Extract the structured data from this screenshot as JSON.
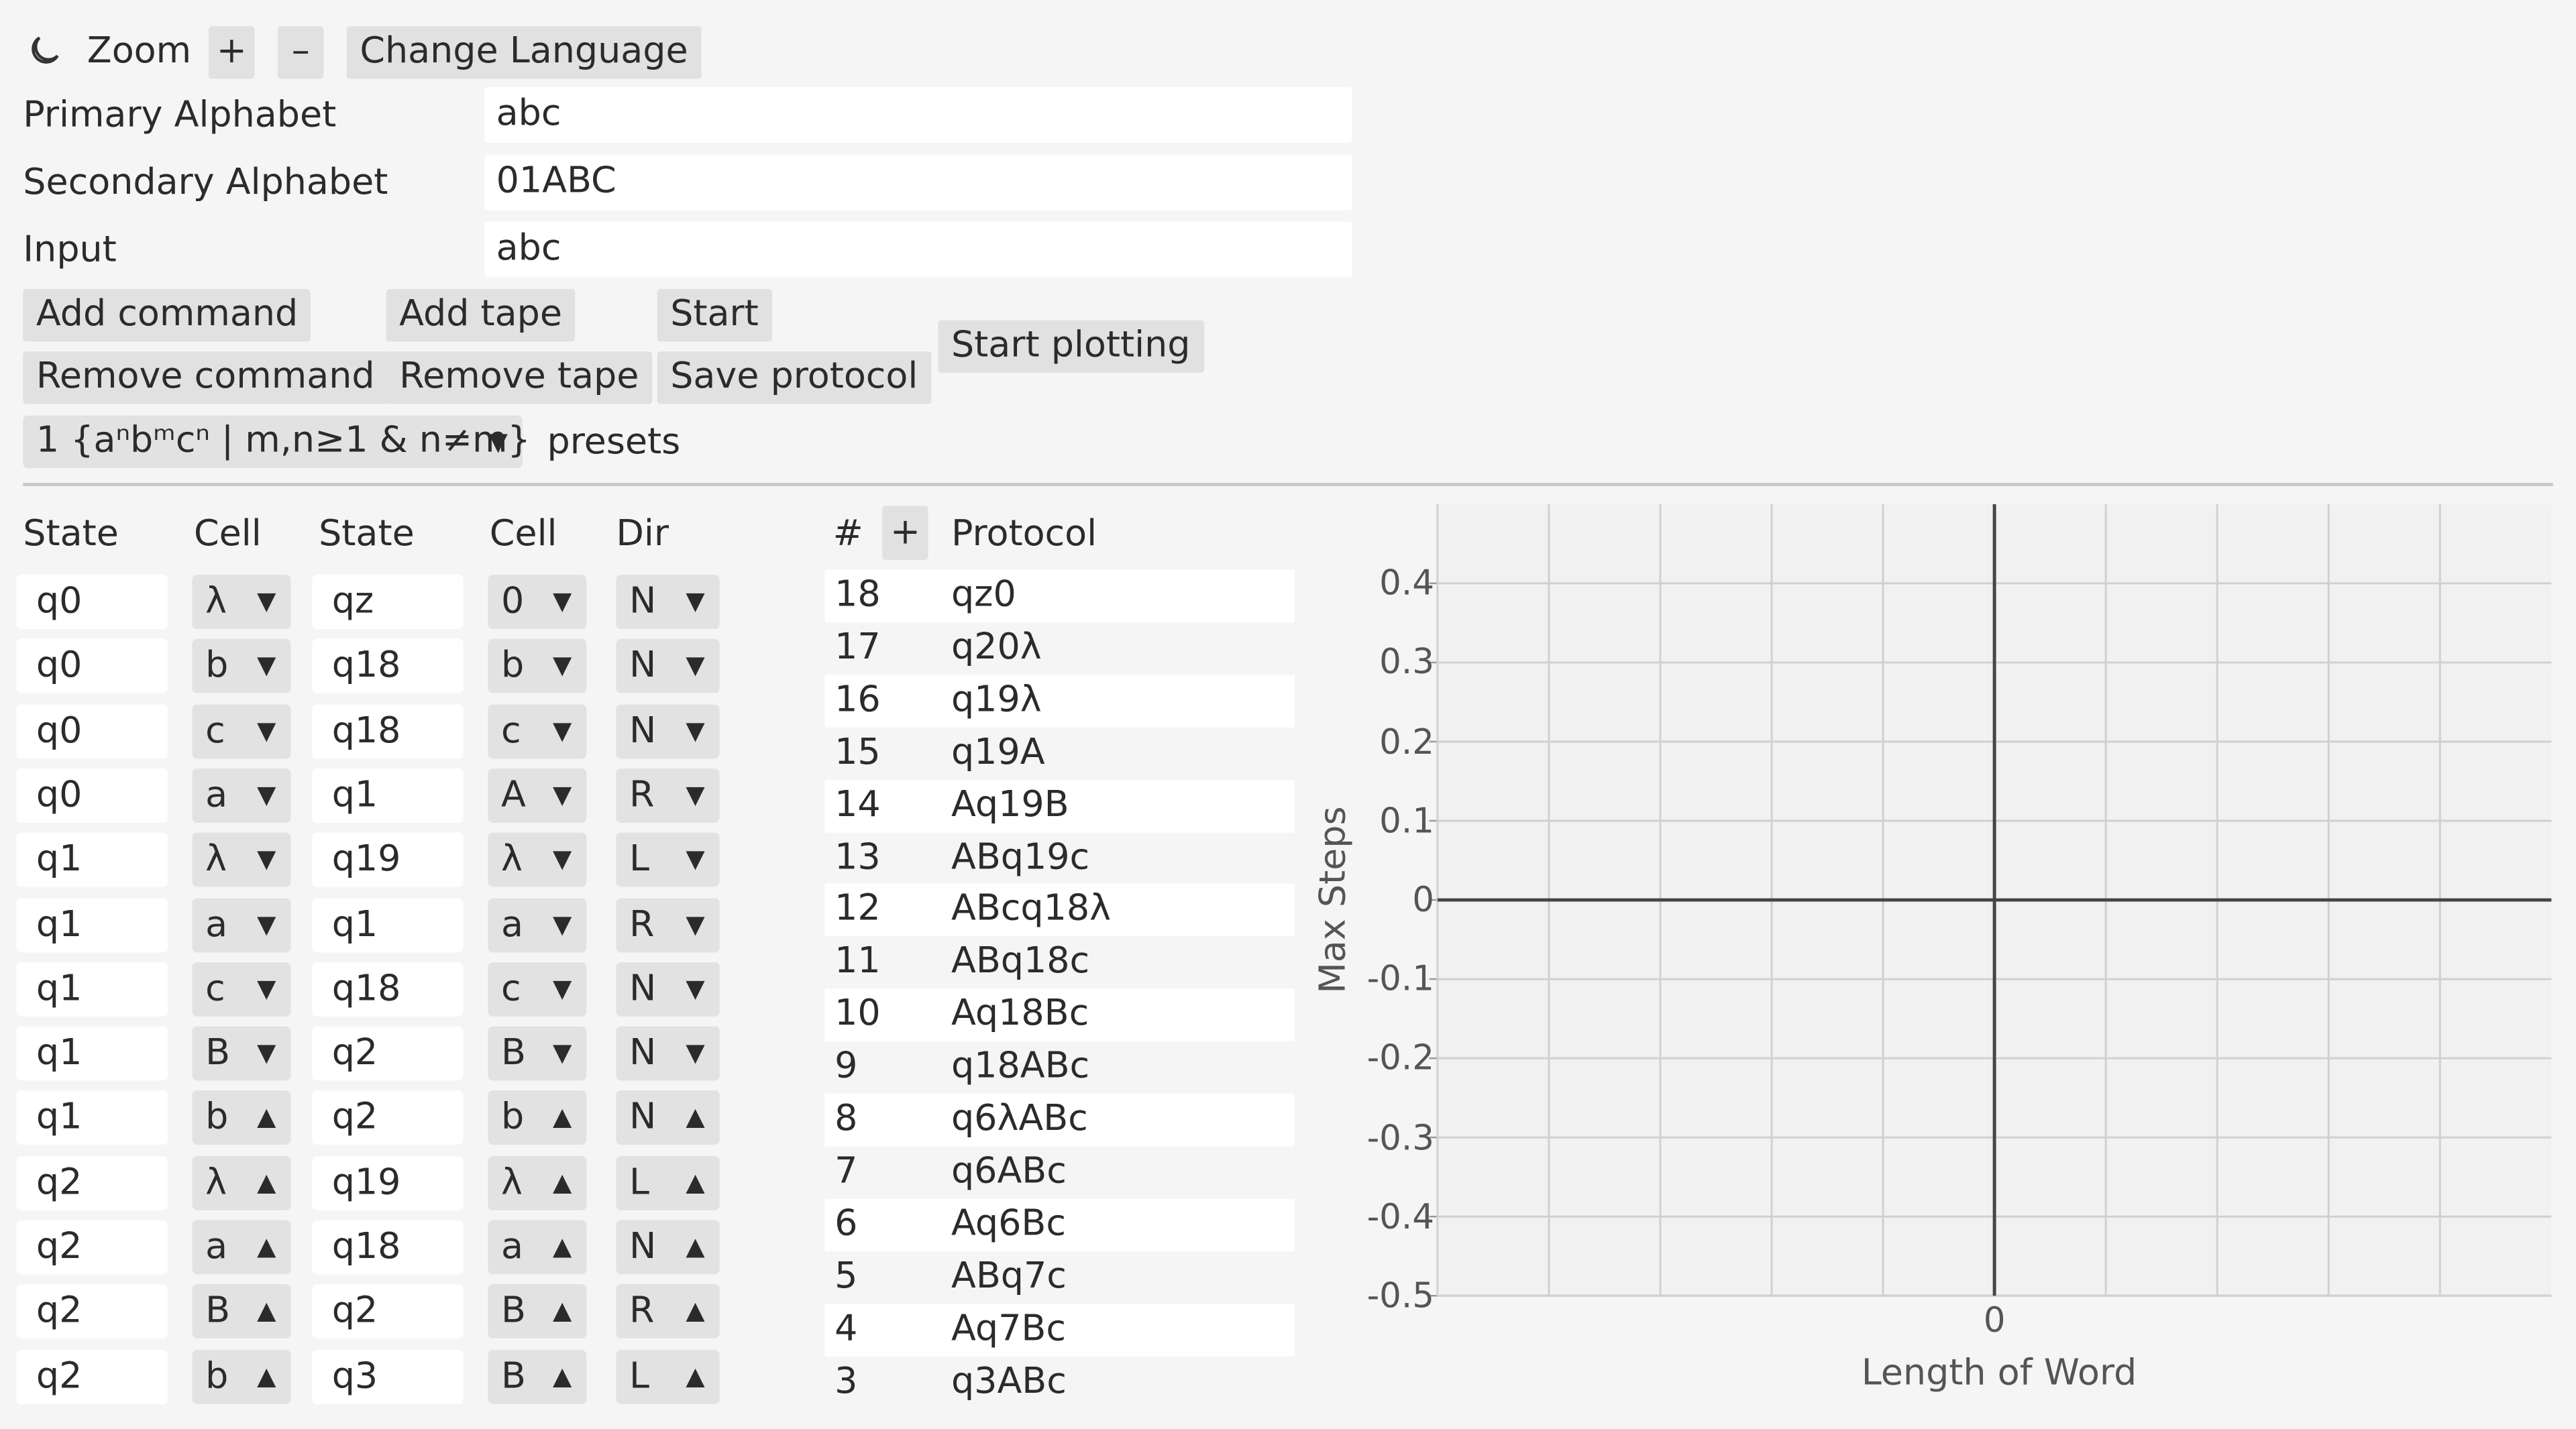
{
  "toolbar": {
    "theme_icon": "moon-icon",
    "zoom_label": "Zoom",
    "zoom_in": "+",
    "zoom_out": "–",
    "language_button": "Change Language"
  },
  "form": {
    "primary_label": "Primary Alphabet",
    "primary_value": "abc",
    "secondary_label": "Secondary Alphabet",
    "secondary_value": "01ABC",
    "input_label": "Input",
    "input_value": "abc"
  },
  "actions": {
    "add_command": "Add command",
    "remove_command": "Remove command",
    "add_tape": "Add tape",
    "remove_tape": "Remove tape",
    "start": "Start",
    "save_protocol": "Save protocol",
    "start_plotting": "Start plotting",
    "preset_selected": "1 {aⁿbᵐcⁿ | m,n≥1 & n≠m}",
    "presets_label": "presets"
  },
  "commands": {
    "headers": {
      "state": "State",
      "cell": "Cell",
      "new_state": "State",
      "new_cell": "Cell",
      "dir": "Dir"
    },
    "rows": [
      {
        "state": "q0",
        "cell": "λ",
        "new_state": "qz",
        "new_cell": "0",
        "dir": "N",
        "open": false
      },
      {
        "state": "q0",
        "cell": "b",
        "new_state": "q18",
        "new_cell": "b",
        "dir": "N",
        "open": false
      },
      {
        "state": "q0",
        "cell": "c",
        "new_state": "q18",
        "new_cell": "c",
        "dir": "N",
        "open": false
      },
      {
        "state": "q0",
        "cell": "a",
        "new_state": "q1",
        "new_cell": "A",
        "dir": "R",
        "open": false
      },
      {
        "state": "q1",
        "cell": "λ",
        "new_state": "q19",
        "new_cell": "λ",
        "dir": "L",
        "open": false
      },
      {
        "state": "q1",
        "cell": "a",
        "new_state": "q1",
        "new_cell": "a",
        "dir": "R",
        "open": false
      },
      {
        "state": "q1",
        "cell": "c",
        "new_state": "q18",
        "new_cell": "c",
        "dir": "N",
        "open": false
      },
      {
        "state": "q1",
        "cell": "B",
        "new_state": "q2",
        "new_cell": "B",
        "dir": "N",
        "open": false
      },
      {
        "state": "q1",
        "cell": "b",
        "new_state": "q2",
        "new_cell": "b",
        "dir": "N",
        "open": true
      },
      {
        "state": "q2",
        "cell": "λ",
        "new_state": "q19",
        "new_cell": "λ",
        "dir": "L",
        "open": true
      },
      {
        "state": "q2",
        "cell": "a",
        "new_state": "q18",
        "new_cell": "a",
        "dir": "N",
        "open": true
      },
      {
        "state": "q2",
        "cell": "B",
        "new_state": "q2",
        "new_cell": "B",
        "dir": "R",
        "open": true
      },
      {
        "state": "q2",
        "cell": "b",
        "new_state": "q3",
        "new_cell": "B",
        "dir": "L",
        "open": true
      }
    ]
  },
  "protocol": {
    "hash_label": "#",
    "add_button": "+",
    "header": "Protocol",
    "rows": [
      {
        "n": "18",
        "config": "qz0"
      },
      {
        "n": "17",
        "config": "q20λ"
      },
      {
        "n": "16",
        "config": "q19λ"
      },
      {
        "n": "15",
        "config": "q19A"
      },
      {
        "n": "14",
        "config": "Aq19B"
      },
      {
        "n": "13",
        "config": "ABq19c"
      },
      {
        "n": "12",
        "config": "ABcq18λ"
      },
      {
        "n": "11",
        "config": "ABq18c"
      },
      {
        "n": "10",
        "config": "Aq18Bc"
      },
      {
        "n": "9",
        "config": "q18ABc"
      },
      {
        "n": "8",
        "config": "q6λABc"
      },
      {
        "n": "7",
        "config": "q6ABc"
      },
      {
        "n": "6",
        "config": "Aq6Bc"
      },
      {
        "n": "5",
        "config": "ABq7c"
      },
      {
        "n": "4",
        "config": "Aq7Bc"
      },
      {
        "n": "3",
        "config": "q3ABc"
      }
    ]
  },
  "chart_data": {
    "type": "scatter",
    "series": [],
    "xlabel": "Length of Word",
    "ylabel": "Max Steps",
    "x_ticks": [
      "0"
    ],
    "y_ticks": [
      "0.4",
      "0.3",
      "0.2",
      "0.1",
      "0",
      "-0.1",
      "-0.2",
      "-0.3",
      "-0.4",
      "-0.5"
    ],
    "ylim": [
      -0.5,
      0.45
    ],
    "grid": true
  }
}
